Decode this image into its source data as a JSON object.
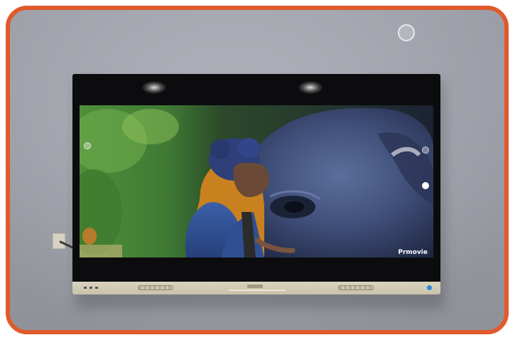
{
  "scene": {
    "frame_color": "#e05a2b",
    "wall_color": "#a9acb5"
  },
  "tv": {
    "screen_watermark": "Prmovie",
    "power_led_color": "#2d8ad8"
  }
}
